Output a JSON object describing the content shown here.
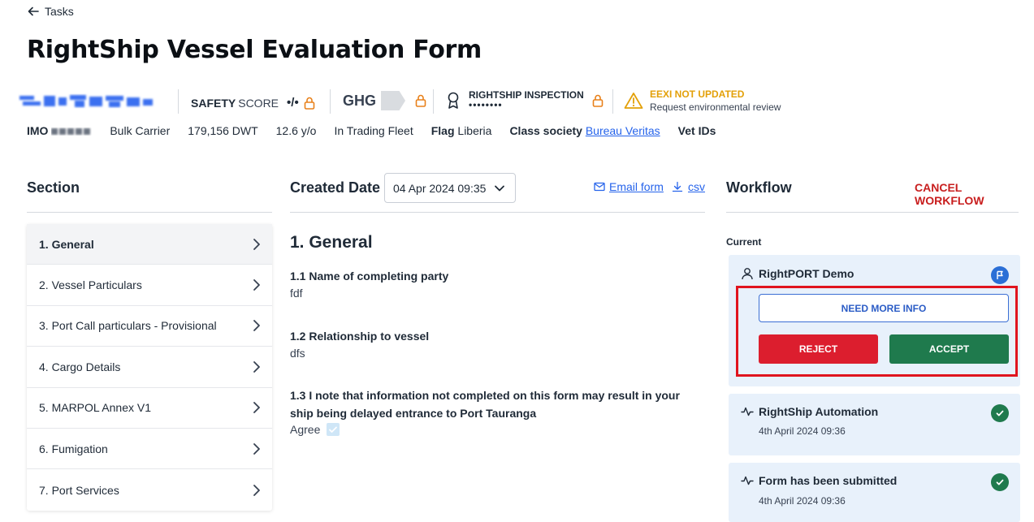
{
  "back": {
    "label": "Tasks"
  },
  "page_title": "RightShip Vessel Evaluation Form",
  "vessel": {
    "safety_label_bold": "SAFETY",
    "safety_label": "SCORE",
    "safety_value": "•/•",
    "ghg_label": "GHG",
    "inspection_label": "RIGHTSHIP INSPECTION",
    "inspection_value": "••••••••",
    "eexi_title": "EEXI NOT UPDATED",
    "eexi_sub": "Request environmental review"
  },
  "meta": {
    "imo_label": "IMO",
    "type": "Bulk Carrier",
    "dwt": "179,156 DWT",
    "age": "12.6 y/o",
    "fleet": "In Trading Fleet",
    "flag_label": "Flag",
    "flag_value": "Liberia",
    "class_label": "Class society",
    "class_value": "Bureau Veritas",
    "vet_label": "Vet IDs"
  },
  "section": {
    "heading": "Section",
    "items": [
      {
        "label": "1. General"
      },
      {
        "label": "2. Vessel Particulars"
      },
      {
        "label": "3. Port Call particulars - Provisional"
      },
      {
        "label": "4. Cargo Details"
      },
      {
        "label": "5. MARPOL Annex V1"
      },
      {
        "label": "6. Fumigation"
      },
      {
        "label": "7. Port Services"
      }
    ]
  },
  "form": {
    "created_label": "Created Date",
    "created_value": "04 Apr 2024 09:35",
    "email_label": "Email form",
    "csv_label": "csv",
    "section_title": "1. General",
    "q1": "1.1 Name of completing party",
    "a1": "fdf",
    "q2": "1.2 Relationship to vessel",
    "a2": "dfs",
    "q3": "1.3 I note that information not completed on this form may result in your ship being delayed entrance to Port Tauranga",
    "a3": "Agree"
  },
  "workflow": {
    "heading": "Workflow",
    "cancel_label": "CANCEL WORKFLOW",
    "current_label": "Current",
    "current_card_title": "RightPORT Demo",
    "need_more_info": "NEED MORE INFO",
    "reject": "REJECT",
    "accept": "ACCEPT",
    "history": [
      {
        "title": "RightShip Automation",
        "time": "4th April 2024 09:36"
      },
      {
        "title": "Form has been submitted",
        "time": "4th April 2024 09:36"
      }
    ]
  },
  "colors": {
    "accent_blue": "#2563eb",
    "reject_red": "#dc1e2e",
    "accept_green": "#1f7a4d",
    "warning_amber": "#e3a008",
    "lock_orange": "#e8801a",
    "highlight_red": "#e0141e"
  }
}
